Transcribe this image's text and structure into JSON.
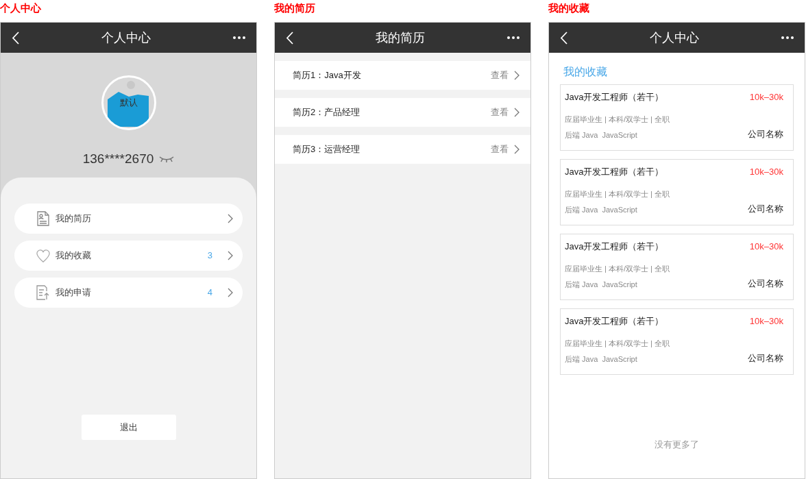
{
  "profile": {
    "caption": "个人中心",
    "nav": {
      "title": "个人中心"
    },
    "avatar": {
      "label": "默认"
    },
    "phone": "136****2670",
    "menu": [
      {
        "kind": "resume",
        "label": "我的简历"
      },
      {
        "kind": "favorite",
        "label": "我的收藏",
        "count": "3"
      },
      {
        "kind": "application",
        "label": "我的申请",
        "count": "4"
      }
    ],
    "logout": "退出"
  },
  "resumes": {
    "caption": "我的简历",
    "nav": {
      "title": "我的简历"
    },
    "items": [
      {
        "title": "简历1：Java开发",
        "action": "查看"
      },
      {
        "title": "简历2：产品经理",
        "action": "查看"
      },
      {
        "title": "简历3：运营经理",
        "action": "查看"
      }
    ]
  },
  "favorites": {
    "caption": "我的收藏",
    "nav": {
      "title": "个人中心"
    },
    "heading": "我的收藏",
    "jobs": [
      {
        "title": "Java开发工程师（若干）",
        "salary": "10k–30k",
        "meta": "应届毕业生 | 本科/双学士 | 全职",
        "tags": "后端 Java  JavaScript",
        "company": "公司名称"
      },
      {
        "title": "Java开发工程师（若干）",
        "salary": "10k–30k",
        "meta": "应届毕业生 | 本科/双学士 | 全职",
        "tags": "后端 Java  JavaScript",
        "company": "公司名称"
      },
      {
        "title": "Java开发工程师（若干）",
        "salary": "10k–30k",
        "meta": "应届毕业生 | 本科/双学士 | 全职",
        "tags": "后端 Java  JavaScript",
        "company": "公司名称"
      },
      {
        "title": "Java开发工程师（若干）",
        "salary": "10k–30k",
        "meta": "应届毕业生 | 本科/双学士 | 全职",
        "tags": "后端 Java  JavaScript",
        "company": "公司名称"
      }
    ],
    "footer": "没有更多了"
  }
}
